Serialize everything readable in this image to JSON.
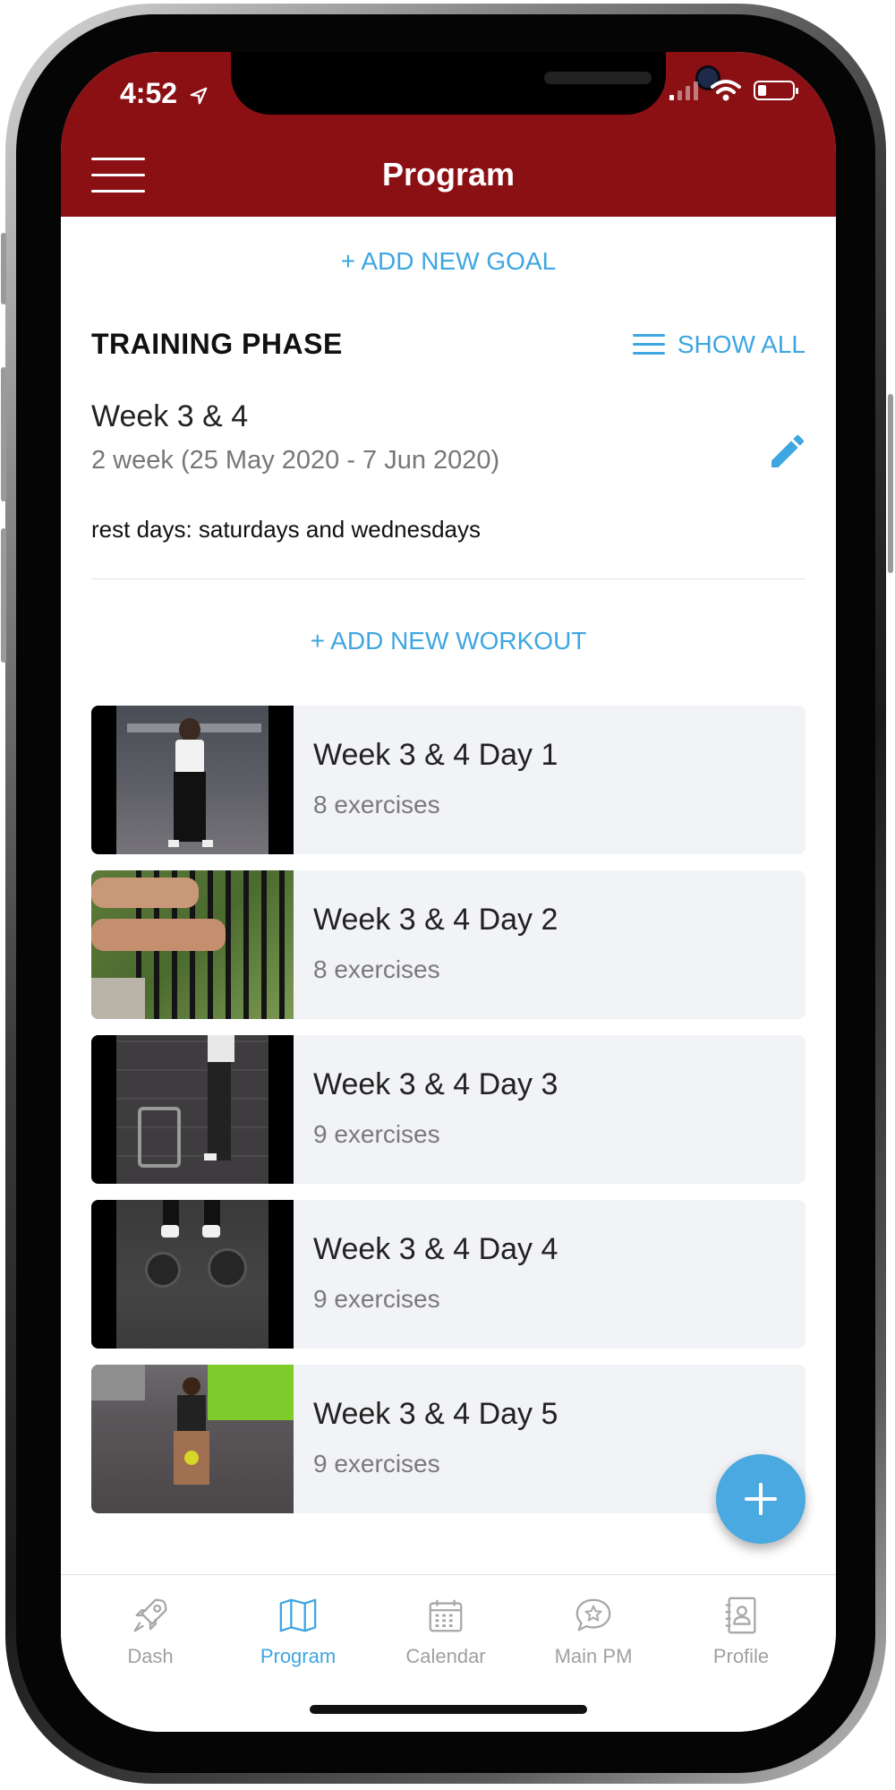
{
  "status_bar": {
    "time": "4:52",
    "icons": [
      "location-arrow-icon",
      "signal-bars-icon",
      "wifi-icon",
      "battery-icon"
    ],
    "battery_level": 0.25
  },
  "header": {
    "title": "Program",
    "menu_icon": "hamburger-menu-icon",
    "background_color": "#8b1014"
  },
  "add_goal_label": "+ ADD NEW GOAL",
  "training_phase": {
    "section_title": "TRAINING PHASE",
    "show_all_label": "SHOW ALL",
    "name": "Week 3 & 4",
    "dates": "2 week (25 May 2020 - 7 Jun 2020)",
    "rest_days": "rest days: saturdays and wednesdays",
    "edit_icon": "pencil-icon"
  },
  "add_workout_label": "+ ADD NEW WORKOUT",
  "workouts": [
    {
      "title": "Week 3 & 4 Day 1",
      "subtitle": "8 exercises"
    },
    {
      "title": "Week 3 & 4 Day 2",
      "subtitle": "8 exercises"
    },
    {
      "title": "Week 3 & 4 Day 3",
      "subtitle": "9 exercises"
    },
    {
      "title": "Week 3 & 4 Day 4",
      "subtitle": "9 exercises"
    },
    {
      "title": "Week 3 & 4 Day 5",
      "subtitle": "9 exercises"
    }
  ],
  "fab_icon": "plus-icon",
  "tabbar": {
    "active": "Program",
    "tabs": [
      {
        "label": "Dash",
        "icon": "rocket-icon"
      },
      {
        "label": "Program",
        "icon": "map-icon"
      },
      {
        "label": "Calendar",
        "icon": "calendar-icon"
      },
      {
        "label": "Main PM",
        "icon": "chat-star-icon"
      },
      {
        "label": "Profile",
        "icon": "contact-book-icon"
      }
    ]
  },
  "colors": {
    "accent": "#3ea6e0",
    "header": "#8b1014",
    "card_background": "#f2f3f6"
  }
}
